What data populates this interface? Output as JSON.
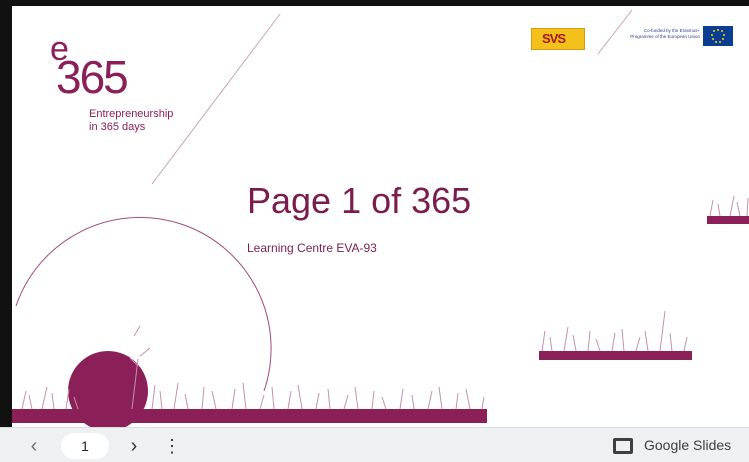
{
  "slide": {
    "logo": {
      "letter": "e",
      "number": "365",
      "tagline_line1": "Entrepreneurship",
      "tagline_line2": "in 365 days"
    },
    "title": "Page 1 of 365",
    "subtitle": "Learning Centre EVA-93",
    "partner_logo_text": "SVS",
    "eu_text": "Co-funded by the Erasmus+ Programme of the European Union",
    "accent_color": "#8b1f58"
  },
  "viewer": {
    "prev_icon": "chevron-left-icon",
    "page_number": "1",
    "next_icon": "chevron-right-icon",
    "more_icon": "more-vert-icon",
    "brand_icon": "slides-icon",
    "brand_label": "Google Slides"
  }
}
